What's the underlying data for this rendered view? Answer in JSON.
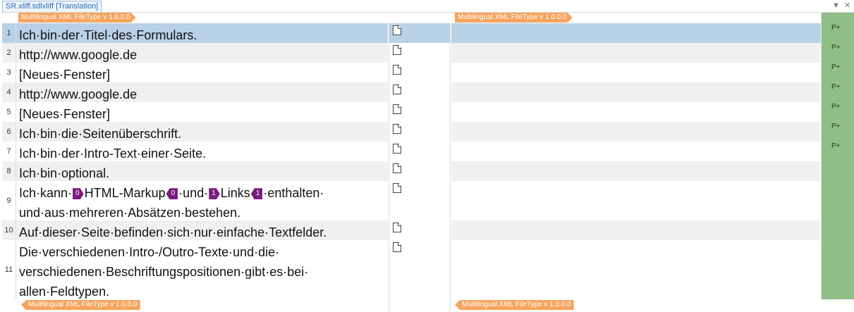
{
  "tab": {
    "label": "SR.xliff.sdlxliff [Translation]"
  },
  "window_controls": {
    "dropdown": "▼",
    "close": "✕"
  },
  "file_tags": {
    "src_open": "Multilingual XML FileType v 1.0.0.0",
    "tgt_open": "Multilingual XML FileType v 1.0.0.0",
    "src_close": "Multilingual XML FileType v 1.0.0.0",
    "tgt_close": "Multilingual XML FileType v 1.0.0.0"
  },
  "segments": [
    {
      "num": "1",
      "lines": [
        [
          {
            "t": "Ich·bin·der·Titel·des·Formulars."
          }
        ]
      ],
      "status": "P+",
      "selected": true
    },
    {
      "num": "2",
      "lines": [
        [
          {
            "t": "http://www.google.de"
          }
        ]
      ],
      "status": "P+"
    },
    {
      "num": "3",
      "lines": [
        [
          {
            "t": "[Neues·Fenster]"
          }
        ]
      ],
      "status": "P+"
    },
    {
      "num": "4",
      "lines": [
        [
          {
            "t": "http://www.google.de"
          }
        ]
      ],
      "status": "P+"
    },
    {
      "num": "5",
      "lines": [
        [
          {
            "t": "[Neues·Fenster]"
          }
        ]
      ],
      "status": "P+"
    },
    {
      "num": "6",
      "lines": [
        [
          {
            "t": "Ich·bin·die·Seitenüberschrift."
          }
        ]
      ],
      "status": "P+"
    },
    {
      "num": "7",
      "lines": [
        [
          {
            "t": "Ich·bin·der·Intro-Text·einer·Seite."
          }
        ]
      ],
      "status": "P+"
    },
    {
      "num": "8",
      "lines": [
        [
          {
            "t": "Ich·bin·optional."
          }
        ]
      ],
      "status": ""
    },
    {
      "num": "9",
      "lines": [
        [
          {
            "t": "Ich·kann·"
          },
          {
            "tag": "0",
            "kind": "open"
          },
          {
            "t": "HTML-Markup"
          },
          {
            "tag": "0",
            "kind": "close"
          },
          {
            "t": "·und·"
          },
          {
            "tag": "1",
            "kind": "open"
          },
          {
            "t": "Links"
          },
          {
            "tag": "1",
            "kind": "close"
          },
          {
            "t": "·enthalten·"
          }
        ],
        [
          {
            "t": "und·aus·mehreren·Absätzen·bestehen."
          }
        ]
      ],
      "status": ""
    },
    {
      "num": "10",
      "lines": [
        [
          {
            "t": "Auf·dieser·Seite·befinden·sich·nur·einfache·Textfelder."
          }
        ]
      ],
      "status": ""
    },
    {
      "num": "11",
      "lines": [
        [
          {
            "t": "Die·verschiedenen·Intro-/Outro-Texte·und·die·"
          }
        ],
        [
          {
            "t": "verschiedenen·Beschriftungspositionen·gibt·es·bei·"
          }
        ],
        [
          {
            "t": "allen·Feldtypen."
          }
        ]
      ],
      "status": ""
    }
  ]
}
